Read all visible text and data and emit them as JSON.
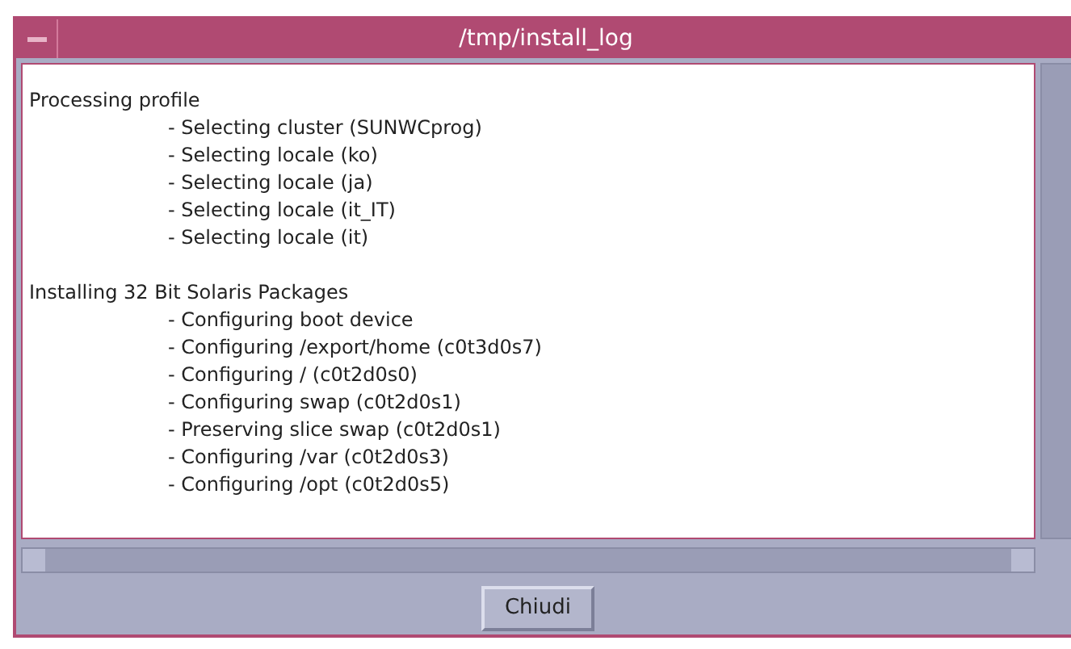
{
  "window": {
    "title": "/tmp/install_log"
  },
  "log": [
    {
      "heading": "Processing profile",
      "items": [
        "- Selecting cluster (SUNWCprog)",
        "- Selecting locale (ko)",
        "- Selecting locale (ja)",
        "- Selecting locale (it_IT)",
        "- Selecting locale (it)"
      ]
    },
    {
      "heading": "Installing 32 Bit Solaris Packages",
      "items": [
        "- Configuring boot device",
        "- Configuring /export/home (c0t3d0s7)",
        "- Configuring / (c0t2d0s0)",
        "- Configuring swap (c0t2d0s1)",
        "- Preserving slice swap (c0t2d0s1)",
        "- Configuring /var (c0t2d0s3)",
        "- Configuring /opt (c0t2d0s5)"
      ]
    }
  ],
  "buttons": [
    "Chiudi"
  ]
}
